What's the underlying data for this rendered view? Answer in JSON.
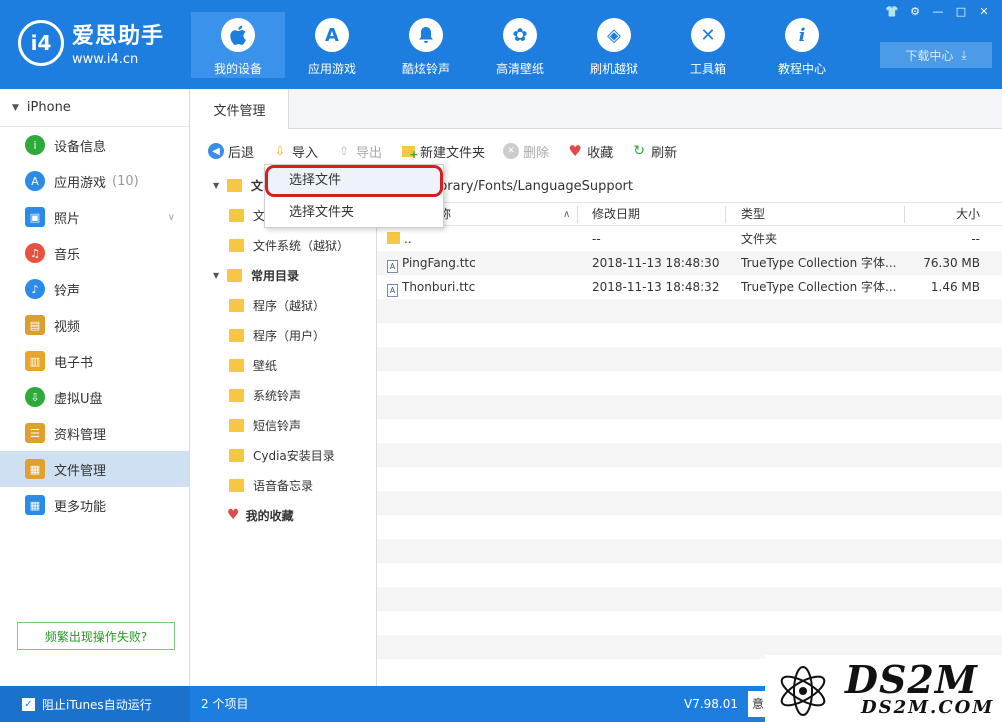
{
  "app": {
    "name": "爱思助手",
    "url": "www.i4.cn",
    "logo_text": "i4"
  },
  "nav": [
    {
      "label": "我的设备",
      "icon": "apple-icon",
      "glyph": ""
    },
    {
      "label": "应用游戏",
      "icon": "app-store-icon",
      "glyph": "A"
    },
    {
      "label": "酷炫铃声",
      "icon": "bell-icon",
      "glyph": "♪"
    },
    {
      "label": "高清壁纸",
      "icon": "flower-icon",
      "glyph": "✿"
    },
    {
      "label": "刷机越狱",
      "icon": "dropbox-icon",
      "glyph": "◈"
    },
    {
      "label": "工具箱",
      "icon": "tools-icon",
      "glyph": "✕"
    },
    {
      "label": "教程中心",
      "icon": "info-icon",
      "glyph": "i"
    }
  ],
  "window_controls": [
    "👕",
    "⚙",
    "—",
    "□",
    "✕"
  ],
  "download_center": "下载中心",
  "device": {
    "name": "iPhone"
  },
  "sidebar": [
    {
      "label": "设备信息",
      "count": "",
      "icon": "info-icon",
      "color": "#2eaa3a",
      "glyph": "i"
    },
    {
      "label": "应用游戏",
      "count": "(10)",
      "icon": "app-store-icon",
      "color": "#2b8be6",
      "glyph": "A"
    },
    {
      "label": "照片",
      "count": "",
      "icon": "photo-icon",
      "color": "#2b8be6",
      "glyph": "▣"
    },
    {
      "label": "音乐",
      "count": "",
      "icon": "music-icon",
      "color": "#e8513f",
      "glyph": "♫"
    },
    {
      "label": "铃声",
      "count": "",
      "icon": "bell-icon",
      "color": "#2b8be6",
      "glyph": "♪"
    },
    {
      "label": "视频",
      "count": "",
      "icon": "film-icon",
      "color": "#d9a030",
      "glyph": "▤"
    },
    {
      "label": "电子书",
      "count": "",
      "icon": "book-icon",
      "color": "#e8a52c",
      "glyph": "▥"
    },
    {
      "label": "虚拟U盘",
      "count": "",
      "icon": "usb-icon",
      "color": "#2eaa3a",
      "glyph": "⇩"
    },
    {
      "label": "资料管理",
      "count": "",
      "icon": "document-icon",
      "color": "#e0a030",
      "glyph": "☰"
    },
    {
      "label": "文件管理",
      "count": "",
      "icon": "files-icon",
      "color": "#e0a030",
      "glyph": "▦"
    },
    {
      "label": "更多功能",
      "count": "",
      "icon": "grid-icon",
      "color": "#2b8be6",
      "glyph": "▦"
    }
  ],
  "fail_button": "频繁出现操作失败?",
  "tab": "文件管理",
  "toolbar": {
    "back": "后退",
    "import": "导入",
    "export": "导出",
    "new_folder": "新建文件夹",
    "delete": "删除",
    "favorite": "收藏",
    "refresh": "刷新"
  },
  "tree": {
    "group1": "文",
    "group1_child1": "文",
    "group1_child2": "文件系统（越狱）",
    "group2": "常用目录",
    "group2_children": [
      "程序（越狱）",
      "程序（用户）",
      "壁纸",
      "系统铃声",
      "短信铃声",
      "Cydia安装目录",
      "语音备忘录"
    ],
    "favorites": "我的收藏"
  },
  "path": "brary/Fonts/LanguageSupport",
  "columns": {
    "name": "称",
    "date": "修改日期",
    "type": "类型",
    "size": "大小"
  },
  "files": [
    {
      "name": "..",
      "date": "--",
      "type": "文件夹",
      "size": "--",
      "kind": "folder"
    },
    {
      "name": "PingFang.ttc",
      "date": "2018-11-13 18:48:30",
      "type": "TrueType Collection 字体...",
      "size": "76.30 MB",
      "kind": "file"
    },
    {
      "name": "Thonburi.ttc",
      "date": "2018-11-13 18:48:32",
      "type": "TrueType Collection 字体...",
      "size": "1.46 MB",
      "kind": "file"
    }
  ],
  "dropdown": {
    "select_file": "选择文件",
    "select_folder": "选择文件夹"
  },
  "statusbar": {
    "itunes_checkbox": "阻止iTunes自动运行",
    "item_count": "2 个项目",
    "version": "V7.98.01",
    "button": "意"
  },
  "watermark": {
    "big": "DS2M",
    "small": "DS2M.COM"
  }
}
